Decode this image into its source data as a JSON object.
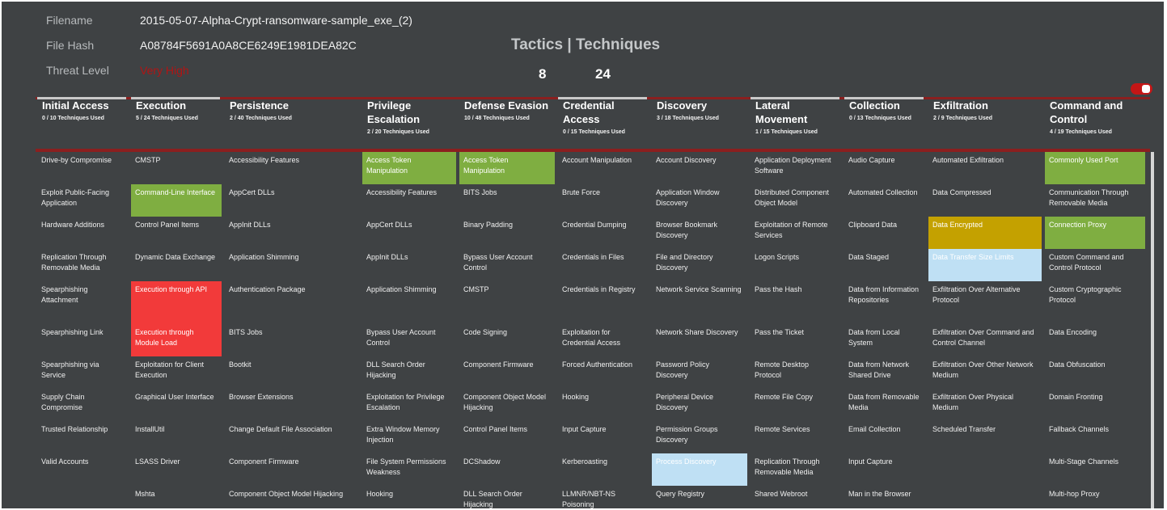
{
  "file": {
    "filename_label": "Filename",
    "filename": "2015-05-07-Alpha-Crypt-ransomware-sample_exe_(2)",
    "hash_label": "File Hash",
    "hash": "A08784F5691A0A8CE6249E1981DEA82C",
    "threat_label": "Threat Level",
    "threat": "Very High"
  },
  "summary": {
    "title": "Tactics | Techniques",
    "tactics": "8",
    "techniques": "24"
  },
  "colors": {
    "green": "#7fae41",
    "red": "#f23a3a",
    "gold": "#c4a100",
    "lightblue": "#bfe0f4",
    "background": "#3f4244",
    "accent": "#8b1f1f"
  },
  "toggle": {
    "state": "on"
  },
  "columns": [
    {
      "name": "Initial Access",
      "count": "0 / 10 Techniques Used",
      "items": [
        {
          "t": "Drive-by Compromise"
        },
        {
          "t": "Exploit Public-Facing Application"
        },
        {
          "t": "Hardware Additions"
        },
        {
          "t": "Replication Through Removable Media"
        },
        {
          "t": "Spearphishing Attachment"
        },
        {
          "t": "Spearphishing Link"
        },
        {
          "t": "Spearphishing via Service"
        },
        {
          "t": "Supply Chain Compromise"
        },
        {
          "t": "Trusted Relationship"
        },
        {
          "t": "Valid Accounts"
        },
        {
          "t": ""
        }
      ]
    },
    {
      "name": "Execution",
      "count": "5 / 24 Techniques Used",
      "items": [
        {
          "t": "CMSTP"
        },
        {
          "t": "Command-Line Interface",
          "hl": "green"
        },
        {
          "t": "Control Panel Items"
        },
        {
          "t": "Dynamic Data Exchange"
        },
        {
          "t": "Execution through API",
          "hl": "red"
        },
        {
          "t": "Execution through Module Load",
          "hl": "red"
        },
        {
          "t": "Exploitation for Client Execution"
        },
        {
          "t": "Graphical User Interface"
        },
        {
          "t": "InstallUtil"
        },
        {
          "t": "LSASS Driver"
        },
        {
          "t": "Mshta"
        }
      ]
    },
    {
      "name": "Persistence",
      "count": "2 / 40 Techniques Used",
      "items": [
        {
          "t": "Accessibility Features"
        },
        {
          "t": "AppCert DLLs"
        },
        {
          "t": "AppInit DLLs"
        },
        {
          "t": "Application Shimming"
        },
        {
          "t": "Authentication Package"
        },
        {
          "t": "BITS Jobs"
        },
        {
          "t": "Bootkit"
        },
        {
          "t": "Browser Extensions"
        },
        {
          "t": "Change Default File Association"
        },
        {
          "t": "Component Firmware"
        },
        {
          "t": "Component Object Model Hijacking"
        }
      ]
    },
    {
      "name": "Privilege Escalation",
      "count": "2 / 20 Techniques Used",
      "items": [
        {
          "t": "Access Token Manipulation",
          "hl": "green"
        },
        {
          "t": "Accessibility Features"
        },
        {
          "t": "AppCert DLLs"
        },
        {
          "t": "AppInit DLLs"
        },
        {
          "t": "Application Shimming"
        },
        {
          "t": "Bypass User Account Control"
        },
        {
          "t": "DLL Search Order Hijacking"
        },
        {
          "t": "Exploitation for Privilege Escalation"
        },
        {
          "t": "Extra Window Memory Injection"
        },
        {
          "t": "File System Permissions Weakness"
        },
        {
          "t": "Hooking"
        }
      ]
    },
    {
      "name": "Defense Evasion",
      "count": "10 / 48 Techniques Used",
      "items": [
        {
          "t": "Access Token Manipulation",
          "hl": "green"
        },
        {
          "t": "BITS Jobs"
        },
        {
          "t": "Binary Padding"
        },
        {
          "t": "Bypass User Account Control"
        },
        {
          "t": "CMSTP"
        },
        {
          "t": "Code Signing"
        },
        {
          "t": "Component Firmware"
        },
        {
          "t": "Component Object Model Hijacking"
        },
        {
          "t": "Control Panel Items"
        },
        {
          "t": "DCShadow"
        },
        {
          "t": "DLL Search Order Hijacking"
        }
      ]
    },
    {
      "name": "Credential Access",
      "count": "0 / 15 Techniques Used",
      "items": [
        {
          "t": "Account Manipulation"
        },
        {
          "t": "Brute Force"
        },
        {
          "t": "Credential Dumping"
        },
        {
          "t": "Credentials in Files"
        },
        {
          "t": "Credentials in Registry"
        },
        {
          "t": "Exploitation for Credential Access"
        },
        {
          "t": "Forced Authentication"
        },
        {
          "t": "Hooking"
        },
        {
          "t": "Input Capture"
        },
        {
          "t": "Kerberoasting"
        },
        {
          "t": "LLMNR/NBT-NS Poisoning"
        }
      ]
    },
    {
      "name": "Discovery",
      "count": "3 / 18 Techniques Used",
      "items": [
        {
          "t": "Account Discovery"
        },
        {
          "t": "Application Window Discovery"
        },
        {
          "t": "Browser Bookmark Discovery"
        },
        {
          "t": "File and Directory Discovery"
        },
        {
          "t": "Network Service Scanning"
        },
        {
          "t": "Network Share Discovery"
        },
        {
          "t": "Password Policy Discovery"
        },
        {
          "t": "Peripheral Device Discovery"
        },
        {
          "t": "Permission Groups Discovery"
        },
        {
          "t": "Process Discovery",
          "hl": "lightblue"
        },
        {
          "t": "Query Registry"
        }
      ]
    },
    {
      "name": "Lateral Movement",
      "count": "1 / 15 Techniques Used",
      "items": [
        {
          "t": "Application Deployment Software"
        },
        {
          "t": "Distributed Component Object Model"
        },
        {
          "t": "Exploitation of Remote Services"
        },
        {
          "t": "Logon Scripts"
        },
        {
          "t": "Pass the Hash"
        },
        {
          "t": "Pass the Ticket"
        },
        {
          "t": "Remote Desktop Protocol"
        },
        {
          "t": "Remote File Copy"
        },
        {
          "t": "Remote Services"
        },
        {
          "t": "Replication Through Removable Media"
        },
        {
          "t": "Shared Webroot"
        }
      ]
    },
    {
      "name": "Collection",
      "count": "0 / 13 Techniques Used",
      "items": [
        {
          "t": "Audio Capture"
        },
        {
          "t": "Automated Collection"
        },
        {
          "t": "Clipboard Data"
        },
        {
          "t": "Data Staged"
        },
        {
          "t": "Data from Information Repositories"
        },
        {
          "t": "Data from Local System"
        },
        {
          "t": "Data from Network Shared Drive"
        },
        {
          "t": "Data from Removable Media"
        },
        {
          "t": "Email Collection"
        },
        {
          "t": "Input Capture"
        },
        {
          "t": "Man in the Browser"
        }
      ]
    },
    {
      "name": "Exfiltration",
      "count": "2 / 9 Techniques Used",
      "items": [
        {
          "t": "Automated Exfiltration"
        },
        {
          "t": "Data Compressed"
        },
        {
          "t": "Data Encrypted",
          "hl": "gold"
        },
        {
          "t": "Data Transfer Size Limits",
          "hl": "lightblue"
        },
        {
          "t": "Exfiltration Over Alternative Protocol"
        },
        {
          "t": "Exfiltration Over Command and Control Channel"
        },
        {
          "t": "Exfiltration Over Other Network Medium"
        },
        {
          "t": "Exfiltration Over Physical Medium"
        },
        {
          "t": "Scheduled Transfer"
        },
        {
          "t": ""
        },
        {
          "t": ""
        }
      ]
    },
    {
      "name": "Command and Control",
      "count": "4 / 19 Techniques Used",
      "items": [
        {
          "t": "Commonly Used Port",
          "hl": "green"
        },
        {
          "t": "Communication Through Removable Media"
        },
        {
          "t": "Connection Proxy",
          "hl": "green"
        },
        {
          "t": "Custom Command and Control Protocol"
        },
        {
          "t": "Custom Cryptographic Protocol"
        },
        {
          "t": "Data Encoding"
        },
        {
          "t": "Data Obfuscation"
        },
        {
          "t": "Domain Fronting"
        },
        {
          "t": "Fallback Channels"
        },
        {
          "t": "Multi-Stage Channels"
        },
        {
          "t": "Multi-hop Proxy"
        }
      ]
    }
  ]
}
